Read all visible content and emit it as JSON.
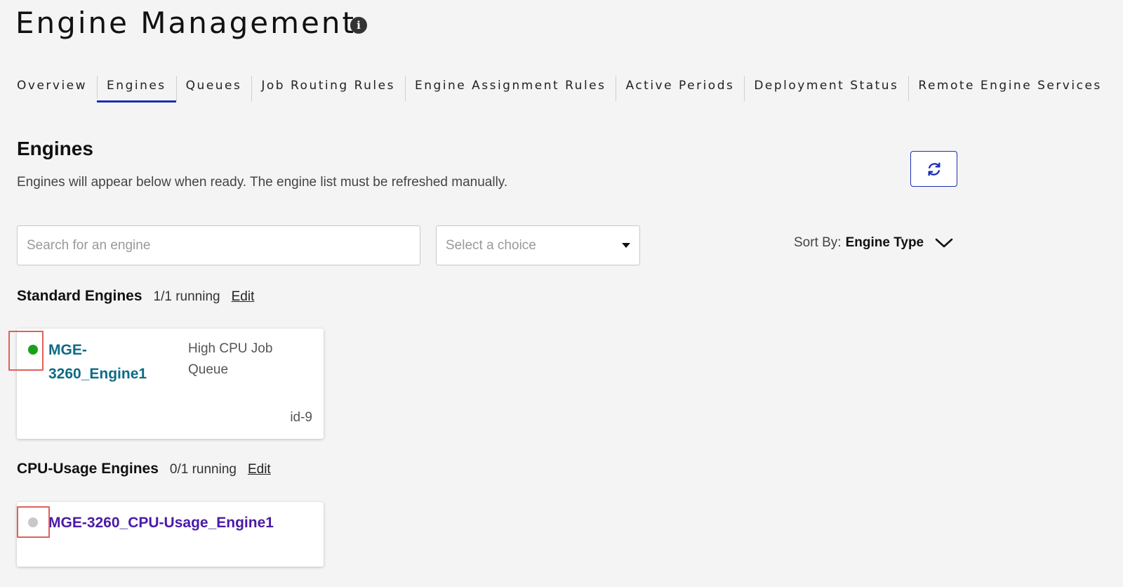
{
  "header": {
    "title": "Engine Management",
    "info_icon": "info-icon"
  },
  "tabs": [
    {
      "label": "Overview",
      "active": false
    },
    {
      "label": "Engines",
      "active": true
    },
    {
      "label": "Queues",
      "active": false
    },
    {
      "label": "Job Routing Rules",
      "active": false
    },
    {
      "label": "Engine Assignment Rules",
      "active": false
    },
    {
      "label": "Active Periods",
      "active": false
    },
    {
      "label": "Deployment Status",
      "active": false
    },
    {
      "label": "Remote Engine Services",
      "active": false
    }
  ],
  "engines_section": {
    "title": "Engines",
    "description": "Engines will appear below when ready. The engine list must be refreshed manually.",
    "refresh_icon": "refresh-icon"
  },
  "filters": {
    "search_placeholder": "Search for an engine",
    "search_value": "",
    "select_value": "Select a choice",
    "sort_label": "Sort By:",
    "sort_value": "Engine Type"
  },
  "groups": [
    {
      "name": "Standard Engines",
      "count": "1/1 running",
      "edit_label": "Edit",
      "engines": [
        {
          "name_line1": "MGE-",
          "name_line2": "3260_Engine1",
          "queue_line1": "High CPU Job",
          "queue_line2": "Queue",
          "id": "id-9",
          "status": "running",
          "status_color": "#1aa01a"
        }
      ]
    },
    {
      "name": "CPU-Usage Engines",
      "count": "0/1 running",
      "edit_label": "Edit",
      "engines": [
        {
          "name": "MGE-3260_CPU-Usage_Engine1",
          "status": "stopped",
          "status_color": "#c8c8c8"
        }
      ]
    }
  ],
  "colors": {
    "accent": "#1b2fb6",
    "running_name": "#0e6b85",
    "stopped_name": "#4b1aa8",
    "highlight": "#e0605a"
  }
}
